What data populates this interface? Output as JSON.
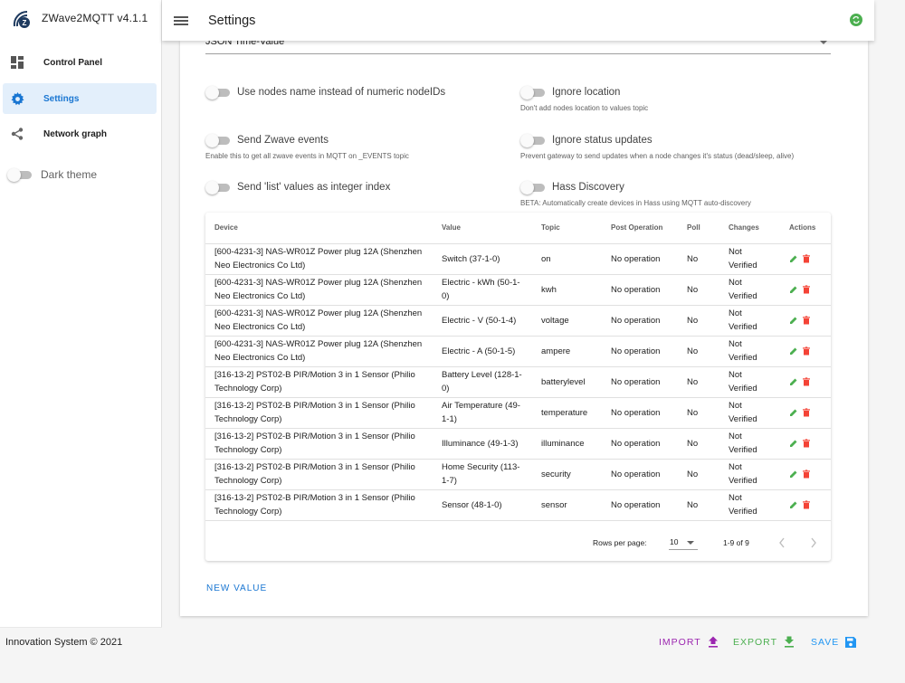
{
  "app": {
    "title": "ZWave2MQTT v4.1.1",
    "footer": "Innovation System © 2021"
  },
  "sidebar": {
    "items": [
      {
        "label": "Control Panel",
        "icon": "dashboard-icon",
        "active": false
      },
      {
        "label": "Settings",
        "icon": "gear-icon",
        "active": true
      },
      {
        "label": "Network graph",
        "icon": "share-icon",
        "active": false
      }
    ],
    "dark_theme_label": "Dark theme",
    "dark_theme_on": false
  },
  "header": {
    "title": "Settings"
  },
  "select": {
    "value": "JSON Time-Value"
  },
  "options": {
    "use_node_names": {
      "label": "Use nodes name instead of numeric nodeIDs",
      "hint": "",
      "on": false
    },
    "ignore_location": {
      "label": "Ignore location",
      "hint": "Don't add nodes location to values topic",
      "on": false
    },
    "send_zwave_events": {
      "label": "Send Zwave events",
      "hint": "Enable this to get all zwave events in MQTT on _EVENTS topic",
      "on": false
    },
    "ignore_status": {
      "label": "Ignore status updates",
      "hint": "Prevent gateway to send updates when a node changes it's status (dead/sleep, alive)",
      "on": false
    },
    "send_list_int": {
      "label": "Send 'list' values as integer index",
      "hint": "",
      "on": false
    },
    "hass_discovery": {
      "label": "Hass Discovery",
      "hint": "BETA: Automatically create devices in Hass using MQTT auto-discovery",
      "on": false
    }
  },
  "table": {
    "headers": {
      "device": "Device",
      "value": "Value",
      "topic": "Topic",
      "post_operation": "Post Operation",
      "poll": "Poll",
      "changes": "Changes",
      "actions": "Actions"
    },
    "rows": [
      {
        "device": "[600-4231-3] NAS-WR01Z Power plug 12A (Shenzhen Neo Electronics Co Ltd)",
        "value": "Switch (37-1-0)",
        "topic": "on",
        "post_operation": "No operation",
        "poll": "No",
        "changes": "Not Verified"
      },
      {
        "device": "[600-4231-3] NAS-WR01Z Power plug 12A (Shenzhen Neo Electronics Co Ltd)",
        "value": "Electric - kWh (50-1-0)",
        "topic": "kwh",
        "post_operation": "No operation",
        "poll": "No",
        "changes": "Not Verified"
      },
      {
        "device": "[600-4231-3] NAS-WR01Z Power plug 12A (Shenzhen Neo Electronics Co Ltd)",
        "value": "Electric - V (50-1-4)",
        "topic": "voltage",
        "post_operation": "No operation",
        "poll": "No",
        "changes": "Not Verified"
      },
      {
        "device": "[600-4231-3] NAS-WR01Z Power plug 12A (Shenzhen Neo Electronics Co Ltd)",
        "value": "Electric - A (50-1-5)",
        "topic": "ampere",
        "post_operation": "No operation",
        "poll": "No",
        "changes": "Not Verified"
      },
      {
        "device": "[316-13-2] PST02-B PIR/Motion 3 in 1 Sensor (Philio Technology Corp)",
        "value": "Battery Level (128-1-0)",
        "topic": "batterylevel",
        "post_operation": "No operation",
        "poll": "No",
        "changes": "Not Verified"
      },
      {
        "device": "[316-13-2] PST02-B PIR/Motion 3 in 1 Sensor (Philio Technology Corp)",
        "value": "Air Temperature (49-1-1)",
        "topic": "temperature",
        "post_operation": "No operation",
        "poll": "No",
        "changes": "Not Verified"
      },
      {
        "device": "[316-13-2] PST02-B PIR/Motion 3 in 1 Sensor (Philio Technology Corp)",
        "value": "Illuminance (49-1-3)",
        "topic": "illuminance",
        "post_operation": "No operation",
        "poll": "No",
        "changes": "Not Verified"
      },
      {
        "device": "[316-13-2] PST02-B PIR/Motion 3 in 1 Sensor (Philio Technology Corp)",
        "value": "Home Security (113-1-7)",
        "topic": "security",
        "post_operation": "No operation",
        "poll": "No",
        "changes": "Not Verified"
      },
      {
        "device": "[316-13-2] PST02-B PIR/Motion 3 in 1 Sensor (Philio Technology Corp)",
        "value": "Sensor (48-1-0)",
        "topic": "sensor",
        "post_operation": "No operation",
        "poll": "No",
        "changes": "Not Verified"
      }
    ],
    "pagination": {
      "rows_per_page_label": "Rows per page:",
      "rows_per_page": "10",
      "range": "1-9 of 9"
    },
    "new_value_label": "NEW VALUE"
  },
  "actions": {
    "import_label": "IMPORT",
    "export_label": "EXPORT",
    "save_label": "SAVE"
  },
  "colors": {
    "primary": "#1976d2",
    "import": "#9c27b0",
    "export": "#4caf50",
    "save": "#2196f3",
    "edit": "#4caf50",
    "delete": "#f44336",
    "status_connected": "#4caf50"
  }
}
